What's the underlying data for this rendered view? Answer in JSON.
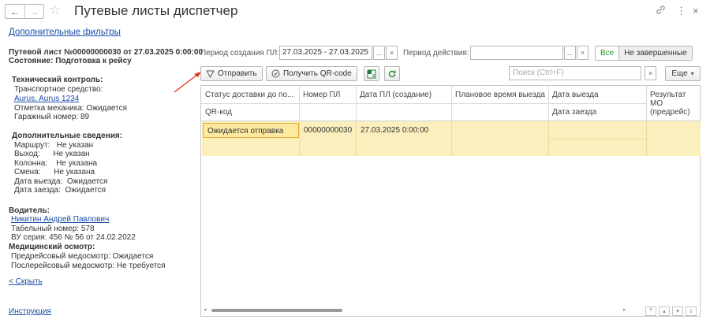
{
  "window": {
    "title": "Путевые листы диспетчер",
    "back_glyph": "←",
    "forward_glyph": "→",
    "star_glyph": "☆",
    "link_glyph": "🔗",
    "menu_glyph": "⋮",
    "close_glyph": "×"
  },
  "left": {
    "filters_link": "Дополнительные фильтры",
    "doc_title": "Путевой лист №00000000030 от 27.03.2025 0:00:00",
    "doc_state": "Состояние: Подготовка к рейсу",
    "tech_header": "Технический контроль:",
    "transport_label": "Транспортное средство:",
    "transport_value": "Aurus, Aurus 1234",
    "mechanic_mark": "Отметка механика: Ожидается",
    "garage_number": "Гаражный номер: 89",
    "extra_header": "Дополнительные сведения:",
    "extra_rows": [
      {
        "label": "Маршрут:",
        "value": "Не указан"
      },
      {
        "label": "Выход:",
        "value": "Не указан"
      },
      {
        "label": "Колонна:",
        "value": "Не указана"
      },
      {
        "label": "Смена:",
        "value": "Не указана"
      },
      {
        "label": "Дата выезда:",
        "value": "Ожидается"
      },
      {
        "label": "Дата заезда:",
        "value": "Ожидается"
      }
    ],
    "driver_header": "Водитель:",
    "driver_name": "Никитин Андрей Павлович",
    "tab_number": "Табельный номер: 578",
    "license": "ВУ серия: 456 № 56 от 24.02.2022",
    "medical_header": "Медицинский осмотр:",
    "pre_medical": "Предрейсовый медосмотр:   Ожидается",
    "post_medical": "Послерейсовый медосмотр:   Не требуется",
    "hide_link": "< Скрыть",
    "instruction_link": "Инструкция"
  },
  "filters": {
    "period_label": "Период создания ПЛ:",
    "period_value": "27.03.2025 - 27.03.2025",
    "dots": "...",
    "clear": "×",
    "action_label": "Период действия:",
    "action_value": "",
    "all_label": "Все",
    "not_finished_label": "Не завершенные"
  },
  "toolbar": {
    "send_label": "Отправить",
    "qr_label": "Получить QR-code",
    "search_placeholder": "Поиск (Ctrl+F)",
    "more_label": "Еще",
    "more_arrow": "▾"
  },
  "table": {
    "headers": [
      "Статус доставки до по...",
      "Номер ПЛ",
      "Дата ПЛ (создание)",
      "Плановое время выезда",
      "Дата выезда",
      "Результат МО (предрейс)"
    ],
    "subheaders": {
      "qr": "QR-код",
      "return_date": "Дата заезда"
    },
    "row": {
      "status": "Ожидается отправка",
      "number": "00000000030",
      "date": "27.03.2025 0:00:00"
    }
  },
  "accent": {
    "arrow": "#e03020",
    "row_bg": "#fbefbe",
    "green": "#2b8a2b"
  }
}
